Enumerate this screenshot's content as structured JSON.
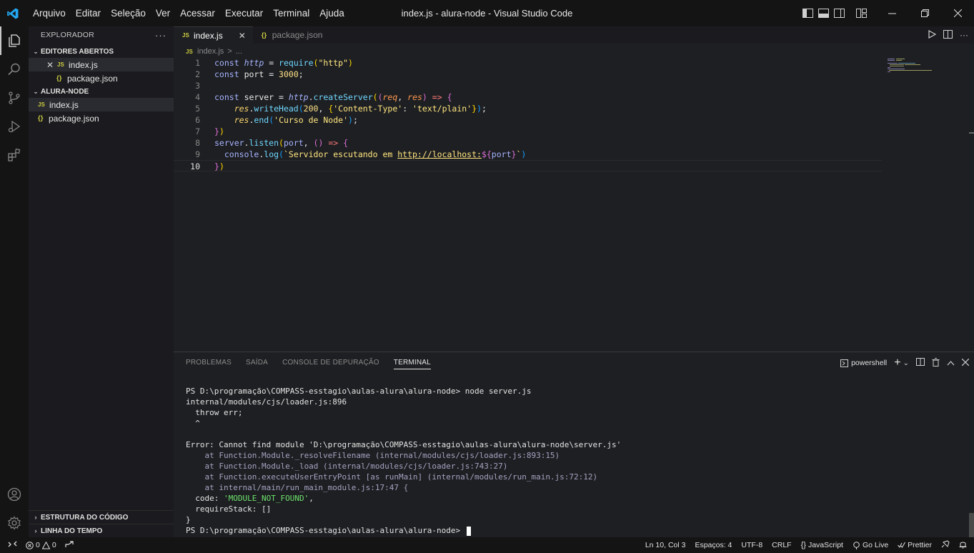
{
  "menu": [
    "Arquivo",
    "Editar",
    "Seleção",
    "Ver",
    "Acessar",
    "Executar",
    "Terminal",
    "Ajuda"
  ],
  "window_title": "index.js - alura-node - Visual Studio Code",
  "sidebar": {
    "title": "EXPLORADOR",
    "open_editors_title": "EDITORES ABERTOS",
    "open_editors": [
      {
        "icon": "JS",
        "label": "index.js"
      },
      {
        "icon": "{}",
        "label": "package.json"
      }
    ],
    "project_title": "ALURA-NODE",
    "files": [
      {
        "icon": "JS",
        "label": "index.js"
      },
      {
        "icon": "{}",
        "label": "package.json"
      }
    ],
    "outline_title": "ESTRUTURA DO CÓDIGO",
    "timeline_title": "LINHA DO TEMPO"
  },
  "tabs": [
    {
      "icon": "JS",
      "label": "index.js",
      "close": "✕"
    },
    {
      "icon": "{}",
      "label": "package.json"
    }
  ],
  "breadcrumbs": {
    "icon": "JS",
    "file": "index.js",
    "sep": ">",
    "more": "..."
  },
  "editor": {
    "line_numbers": [
      "1",
      "2",
      "3",
      "4",
      "5",
      "6",
      "7",
      "8",
      "9",
      "10"
    ],
    "code": {
      "l1": {
        "kw": "const",
        "var": "http",
        "eq": " = ",
        "fn": "require",
        "p1": "(",
        "str": "\"http\"",
        "p2": ")"
      },
      "l2": {
        "kw": "const",
        "var": "port",
        "eq": " = ",
        "num": "3000",
        "end": ";"
      },
      "l4": {
        "kw": "const",
        "var": "server",
        "eq": " = ",
        "obj": "http",
        "dot": ".",
        "fn": "createServer",
        "p1": "(",
        "p2": "(",
        "a1": "req",
        "comma": ", ",
        "a2": "res",
        "p3": ")",
        "arrow": " => ",
        "br": "{"
      },
      "l5": {
        "obj": "res",
        "dot": ".",
        "fn": "writeHead",
        "p1": "(",
        "num": "200",
        "comma": ", ",
        "br1": "{",
        "s1": "'Content-Type'",
        "colon": ": ",
        "s2": "'text/plain'",
        "br2": "}",
        "p2": ")",
        "end": ";"
      },
      "l6": {
        "obj": "res",
        "dot": ".",
        "fn": "end",
        "p1": "(",
        "str": "'Curso de Node'",
        "p2": ")",
        "end": ";"
      },
      "l7": {
        "br": "}",
        "p": ")"
      },
      "l8": {
        "obj": "server",
        "dot": ".",
        "fn": "listen",
        "p1": "(",
        "arg": "port",
        "comma": ", ",
        "p2": "()",
        "arrow": " => ",
        "br": "{"
      },
      "l9": {
        "obj": "console",
        "dot": ".",
        "fn": "log",
        "p1": "(",
        "tpl": "`Servidor escutando em ",
        "url": "http://localhost:",
        "d1": "${",
        "v": "port",
        "d2": "}",
        "tpl2": "`",
        "p2": ")"
      },
      "l10": {
        "br": "}",
        "p": ")"
      }
    }
  },
  "panel": {
    "tabs": [
      "PROBLEMAS",
      "SAÍDA",
      "CONSOLE DE DEPURAÇÃO",
      "TERMINAL"
    ],
    "shell": "powershell",
    "terminal": {
      "l1_prompt": "PS D:\\programação\\COMPASS-esstagio\\aulas-alura\\alura-node> ",
      "l1_cmd": "node server.js",
      "l2": "internal/modules/cjs/loader.js:896",
      "l3": "  throw err;",
      "l4": "  ^",
      "l6": "Error: Cannot find module 'D:\\programação\\COMPASS-esstagio\\aulas-alura\\alura-node\\server.js'",
      "l7": "    at Function.Module._resolveFilename (internal/modules/cjs/loader.js:893:15)",
      "l8": "    at Function.Module._load (internal/modules/cjs/loader.js:743:27)",
      "l9": "    at Function.executeUserEntryPoint [as runMain] (internal/modules/run_main.js:72:12)",
      "l10": "    at internal/main/run_main_module.js:17:47 {",
      "l11_key": "  code: ",
      "l11_val": "'MODULE_NOT_FOUND'",
      "l11_end": ",",
      "l12": "  requireStack: []",
      "l13": "}",
      "l14_prompt": "PS D:\\programação\\COMPASS-esstagio\\aulas-alura\\alura-node> "
    }
  },
  "status": {
    "errors": "0",
    "warnings": "0",
    "position": "Ln 10, Col 3",
    "spaces": "Espaços: 4",
    "encoding": "UTF-8",
    "eol": "CRLF",
    "language": "JavaScript",
    "golive": "Go Live",
    "prettier": "Prettier"
  },
  "colors": {
    "accent": "#007acc",
    "background": "#1e1f22",
    "activity": "#141414"
  }
}
